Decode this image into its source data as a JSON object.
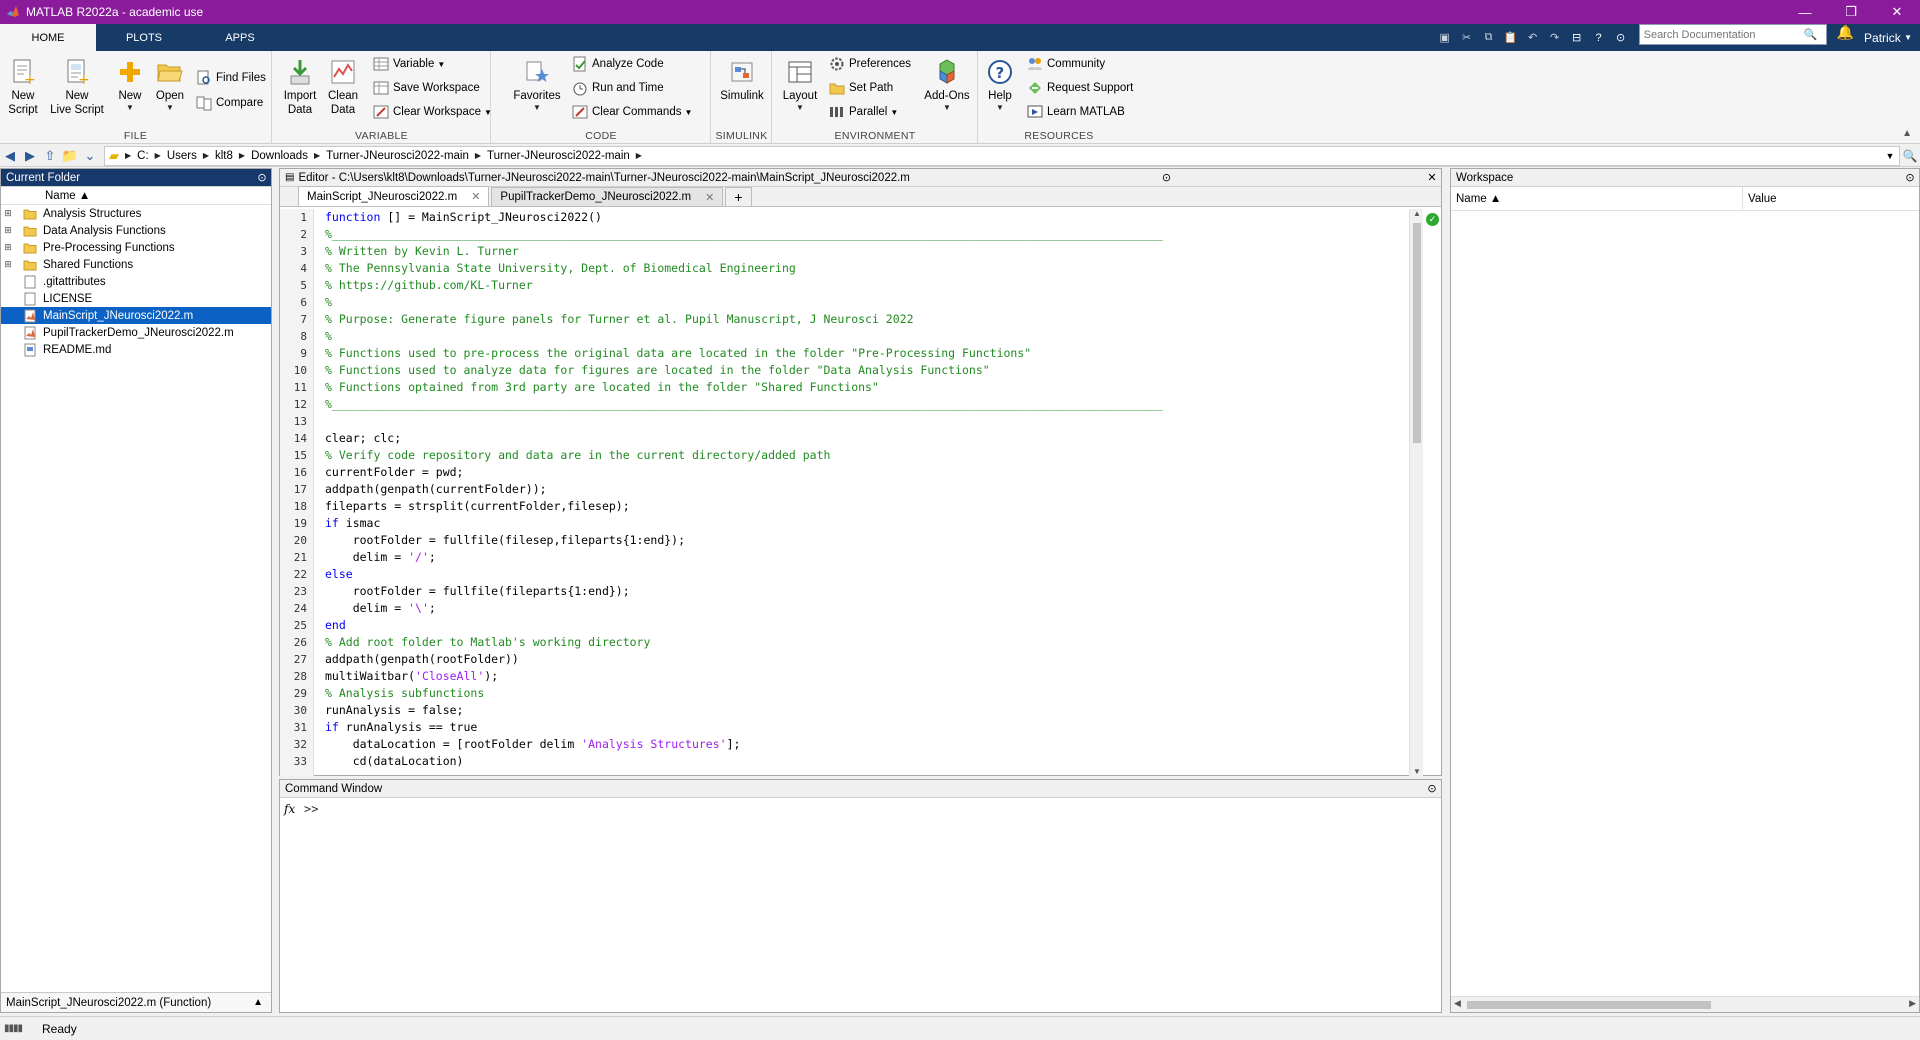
{
  "window": {
    "title": "MATLAB R2022a - academic use",
    "controls": [
      "—",
      "❐",
      "✕"
    ]
  },
  "tabs": [
    "HOME",
    "PLOTS",
    "APPS"
  ],
  "search": {
    "placeholder": "Search Documentation"
  },
  "user": "Patrick",
  "ribbon": {
    "file": {
      "label": "FILE",
      "new_script": [
        "New",
        "Script"
      ],
      "new_live_script": [
        "New",
        "Live Script"
      ],
      "new": "New",
      "open": "Open",
      "find_files": "Find Files",
      "compare": "Compare"
    },
    "variable": {
      "label": "VARIABLE",
      "import_data": [
        "Import",
        "Data"
      ],
      "clean_data": [
        "Clean",
        "Data"
      ],
      "variable": "Variable",
      "save_workspace": "Save Workspace",
      "clear_workspace": "Clear Workspace"
    },
    "code": {
      "label": "CODE",
      "favorites": "Favorites",
      "analyze_code": "Analyze Code",
      "run_and_time": "Run and Time",
      "clear_commands": "Clear Commands"
    },
    "simulink": {
      "label": "SIMULINK",
      "simulink": "Simulink"
    },
    "environment": {
      "label": "ENVIRONMENT",
      "layout": "Layout",
      "preferences": "Preferences",
      "set_path": "Set Path",
      "parallel": "Parallel",
      "add_ons": "Add-Ons"
    },
    "resources": {
      "label": "RESOURCES",
      "help": "Help",
      "community": "Community",
      "request_support": "Request Support",
      "learn_matlab": "Learn MATLAB"
    }
  },
  "address": {
    "crumbs": [
      "C:",
      "Users",
      "klt8",
      "Downloads",
      "Turner-JNeurosci2022-main",
      "Turner-JNeurosci2022-main"
    ]
  },
  "current_folder": {
    "title": "Current Folder",
    "column": "Name ▲",
    "items": [
      {
        "name": "Analysis Structures",
        "type": "folder"
      },
      {
        "name": "Data Analysis Functions",
        "type": "folder"
      },
      {
        "name": "Pre-Processing Functions",
        "type": "folder"
      },
      {
        "name": "Shared Functions",
        "type": "folder"
      },
      {
        "name": ".gitattributes",
        "type": "file"
      },
      {
        "name": "LICENSE",
        "type": "file"
      },
      {
        "name": "MainScript_JNeurosci2022.m",
        "type": "mfile",
        "selected": true
      },
      {
        "name": "PupilTrackerDemo_JNeurosci2022.m",
        "type": "mfile"
      },
      {
        "name": "README.md",
        "type": "md"
      }
    ],
    "status": "MainScript_JNeurosci2022.m  (Function)"
  },
  "editor": {
    "title": "Editor - C:\\Users\\klt8\\Downloads\\Turner-JNeurosci2022-main\\Turner-JNeurosci2022-main\\MainScript_JNeurosci2022.m",
    "tabs": [
      "MainScript_JNeurosci2022.m",
      "PupilTrackerDemo_JNeurosci2022.m"
    ],
    "lines": [
      [
        [
          "kw",
          "function"
        ],
        [
          "t",
          " [] = MainScript_JNeurosci2022()"
        ]
      ],
      [
        [
          "com",
          "%________________________________________________________________________________________________________________________"
        ]
      ],
      [
        [
          "com",
          "% Written by Kevin L. Turner"
        ]
      ],
      [
        [
          "com",
          "% The Pennsylvania State University, Dept. of Biomedical Engineering"
        ]
      ],
      [
        [
          "com",
          "% https://github.com/KL-Turner"
        ]
      ],
      [
        [
          "com",
          "%"
        ]
      ],
      [
        [
          "com",
          "% Purpose: Generate figure panels for Turner et al. Pupil Manuscript, J Neurosci 2022"
        ]
      ],
      [
        [
          "com",
          "%"
        ]
      ],
      [
        [
          "com",
          "% Functions used to pre-process the original data are located in the folder \"Pre-Processing Functions\""
        ]
      ],
      [
        [
          "com",
          "% Functions used to analyze data for figures are located in the folder \"Data Analysis Functions\""
        ]
      ],
      [
        [
          "com",
          "% Functions optained from 3rd party are located in the folder \"Shared Functions\""
        ]
      ],
      [
        [
          "com",
          "%________________________________________________________________________________________________________________________"
        ]
      ],
      [
        [
          "t",
          ""
        ]
      ],
      [
        [
          "t",
          "clear; clc;"
        ]
      ],
      [
        [
          "com",
          "% Verify code repository and data are in the current directory/added path"
        ]
      ],
      [
        [
          "t",
          "currentFolder = pwd;"
        ]
      ],
      [
        [
          "t",
          "addpath(genpath(currentFolder));"
        ]
      ],
      [
        [
          "t",
          "fileparts = strsplit(currentFolder,filesep);"
        ]
      ],
      [
        [
          "kw",
          "if"
        ],
        [
          "t",
          " ismac"
        ]
      ],
      [
        [
          "t",
          "    rootFolder = fullfile(filesep,fileparts{1:end});"
        ]
      ],
      [
        [
          "t",
          "    delim = "
        ],
        [
          "str",
          "'/'"
        ],
        [
          "t",
          ";"
        ]
      ],
      [
        [
          "kw",
          "else"
        ]
      ],
      [
        [
          "t",
          "    rootFolder = fullfile(fileparts{1:end});"
        ]
      ],
      [
        [
          "t",
          "    delim = "
        ],
        [
          "str",
          "'\\'"
        ],
        [
          "t",
          ";"
        ]
      ],
      [
        [
          "kw",
          "end"
        ]
      ],
      [
        [
          "com",
          "% Add root folder to Matlab's working directory"
        ]
      ],
      [
        [
          "t",
          "addpath(genpath(rootFolder))"
        ]
      ],
      [
        [
          "t",
          "multiWaitbar("
        ],
        [
          "str",
          "'CloseAll'"
        ],
        [
          "t",
          ");"
        ]
      ],
      [
        [
          "com",
          "% Analysis subfunctions"
        ]
      ],
      [
        [
          "t",
          "runAnalysis = false;"
        ]
      ],
      [
        [
          "kw",
          "if"
        ],
        [
          "t",
          " runAnalysis == true"
        ]
      ],
      [
        [
          "t",
          "    dataLocation = [rootFolder delim "
        ],
        [
          "str",
          "'Analysis Structures'"
        ],
        [
          "t",
          "];"
        ]
      ],
      [
        [
          "t",
          "    cd(dataLocation)"
        ]
      ]
    ]
  },
  "command_window": {
    "title": "Command Window",
    "fx": "fx",
    "prompt": ">>"
  },
  "workspace": {
    "title": "Workspace",
    "col_name": "Name ▲",
    "col_value": "Value"
  },
  "status": "Ready"
}
